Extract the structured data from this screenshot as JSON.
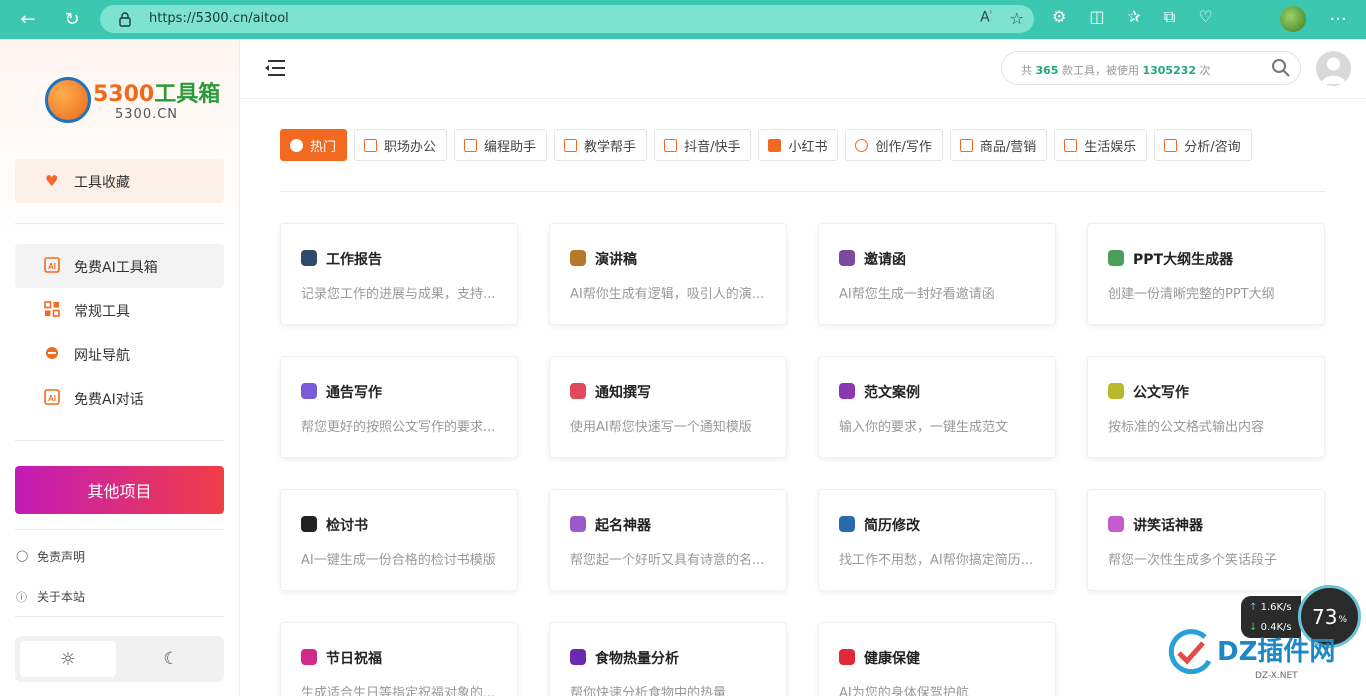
{
  "browser": {
    "url": "https://5300.cn/aitool"
  },
  "sidebar": {
    "logo_title": "5300工具箱",
    "logo_num": "5300",
    "logo_name": "工具箱",
    "logo_sub": "5300.CN",
    "favorites": "工具收藏",
    "nav": [
      {
        "label": "免费AI工具箱",
        "icon": "ai-icon"
      },
      {
        "label": "常规工具",
        "icon": "grid-icon"
      },
      {
        "label": "网址导航",
        "icon": "ie-icon"
      },
      {
        "label": "免费AI对话",
        "icon": "ai-chat-icon"
      }
    ],
    "other_projects": "其他项目",
    "disclaimer": "免责声明",
    "about": "关于本站"
  },
  "header": {
    "search_prefix": "共",
    "tool_count": "365",
    "search_mid": "款工具，被使用",
    "use_count": "1305232",
    "search_suffix": "次"
  },
  "tabs": [
    {
      "label": "热门"
    },
    {
      "label": "职场办公"
    },
    {
      "label": "编程助手"
    },
    {
      "label": "教学帮手"
    },
    {
      "label": "抖音/快手"
    },
    {
      "label": "小红书"
    },
    {
      "label": "创作/写作"
    },
    {
      "label": "商品/营销"
    },
    {
      "label": "生活娱乐"
    },
    {
      "label": "分析/咨询"
    }
  ],
  "cards": [
    {
      "title": "工作报告",
      "desc": "记录您工作的进展与成果，支持...",
      "color": "#2f4a6b"
    },
    {
      "title": "演讲稿",
      "desc": "AI帮你生成有逻辑，吸引人的演...",
      "color": "#b47a2a"
    },
    {
      "title": "邀请函",
      "desc": "AI帮您生成一封好看邀请函",
      "color": "#7b4aa0"
    },
    {
      "title": "PPT大纲生成器",
      "desc": "创建一份清晰完整的PPT大纲",
      "color": "#4aa05a"
    },
    {
      "title": "通告写作",
      "desc": "帮您更好的按照公文写作的要求...",
      "color": "#7a5ad6"
    },
    {
      "title": "通知撰写",
      "desc": "使用AI帮您快速写一个通知模版",
      "color": "#e04a5a"
    },
    {
      "title": "范文案例",
      "desc": "输入你的要求，一键生成范文",
      "color": "#8a3ab0"
    },
    {
      "title": "公文写作",
      "desc": "按标准的公文格式输出内容",
      "color": "#b8b82a"
    },
    {
      "title": "检讨书",
      "desc": "AI一键生成一份合格的检讨书模版",
      "color": "#222222"
    },
    {
      "title": "起名神器",
      "desc": "帮您起一个好听又具有诗意的名...",
      "color": "#9a5ac8"
    },
    {
      "title": "简历修改",
      "desc": "找工作不用愁，AI帮你搞定简历...",
      "color": "#2a6ab0"
    },
    {
      "title": "讲笑话神器",
      "desc": "帮您一次性生成多个笑话段子",
      "color": "#c85ad0"
    },
    {
      "title": "节日祝福",
      "desc": "生成适合生日等指定祝福对象的...",
      "color": "#d02a8a"
    },
    {
      "title": "食物热量分析",
      "desc": "帮你快速分析食物中的热量",
      "color": "#6a2ab0"
    },
    {
      "title": "健康保健",
      "desc": "AI为您的身体保驾护航",
      "color": "#e02a3a"
    }
  ],
  "widget": {
    "up": "1.6K/s",
    "down": "0.4K/s",
    "percent": "73",
    "percent_unit": "%"
  },
  "watermark": {
    "text": "DZ插件网",
    "sub": "DZ-X.NET"
  }
}
